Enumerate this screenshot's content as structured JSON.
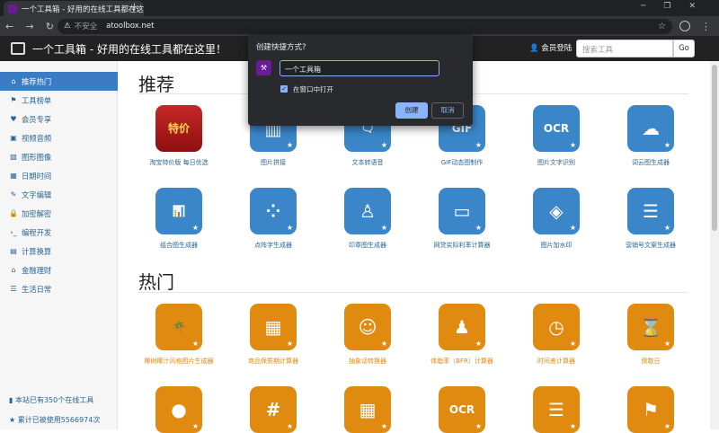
{
  "browser": {
    "tab_title": "一个工具箱 - 好用的在线工具都在这里！",
    "new_tab": "+",
    "security_label": "不安全",
    "url": "atoolbox.net"
  },
  "site": {
    "title": "一个工具箱 - 好用的在线工具都在这里！",
    "login_label": "会员登陆",
    "search_placeholder": "搜索工具",
    "go_label": "Go"
  },
  "sidebar": {
    "items": [
      {
        "icon": "home-icon",
        "glyph": "⌂",
        "label": "推荐热门"
      },
      {
        "icon": "flag-icon",
        "glyph": "⚑",
        "label": "工具榜单"
      },
      {
        "icon": "heart-icon",
        "glyph": "♥",
        "label": "会员专享"
      },
      {
        "icon": "film-icon",
        "glyph": "▣",
        "label": "视频音频"
      },
      {
        "icon": "image-icon",
        "glyph": "▨",
        "label": "图形图像"
      },
      {
        "icon": "calendar-icon",
        "glyph": "▦",
        "label": "日期时间"
      },
      {
        "icon": "pen-icon",
        "glyph": "✎",
        "label": "文字编辑"
      },
      {
        "icon": "lock-icon",
        "glyph": "🔒",
        "label": "加密解密"
      },
      {
        "icon": "terminal-icon",
        "glyph": "›_",
        "label": "编程开发"
      },
      {
        "icon": "calculator-icon",
        "glyph": "▤",
        "label": "计算换算"
      },
      {
        "icon": "bank-icon",
        "glyph": "⌂",
        "label": "金融理财"
      },
      {
        "icon": "list-icon",
        "glyph": "☰",
        "label": "生活日常"
      }
    ],
    "footer_tools": "本站已有350个在线工具",
    "footer_uses": "累计已被使用5566974次"
  },
  "sections": {
    "recommended": "推荐",
    "popular": "热门"
  },
  "recommended_row1": [
    {
      "icon": "taobao-promo-image",
      "glyph": "特价",
      "label": "淘宝特价版 每日优选",
      "style": "image"
    },
    {
      "icon": "image-collage-icon",
      "glyph": "▥",
      "label": "图片拼接",
      "style": "blue"
    },
    {
      "icon": "speech-bubble-icon",
      "glyph": "🗨",
      "label": "文本转语音",
      "style": "blue"
    },
    {
      "icon": "gif-film-icon",
      "glyph": "GIF",
      "label": "GIF动态图制作",
      "style": "blue"
    },
    {
      "icon": "ocr-icon",
      "glyph": "OCR",
      "label": "图片文字识别",
      "style": "blue"
    },
    {
      "icon": "cloud-icon",
      "glyph": "☁",
      "label": "词云图生成器",
      "style": "blue"
    }
  ],
  "recommended_row2": [
    {
      "icon": "bar-chart-icon",
      "glyph": "📊",
      "label": "组合图生成器",
      "style": "blue"
    },
    {
      "icon": "dot-matrix-icon",
      "glyph": "⁘",
      "label": "点阵字生成器",
      "style": "blue"
    },
    {
      "icon": "stamp-icon",
      "glyph": "♙",
      "label": "印章图生成器",
      "style": "blue"
    },
    {
      "icon": "monitor-icon",
      "glyph": "▭",
      "label": "网贷实际利率计算器",
      "style": "blue"
    },
    {
      "icon": "layers-icon",
      "glyph": "◈",
      "label": "图片加水印",
      "style": "blue"
    },
    {
      "icon": "document-icon",
      "glyph": "☰",
      "label": "营销号文案生成器",
      "style": "blue"
    }
  ],
  "popular_row1": [
    {
      "icon": "palm-tree-icon",
      "glyph": "🌴",
      "label": "椰树椰汁风格图片生成器",
      "style": "orange"
    },
    {
      "icon": "calendar-grid-icon",
      "glyph": "▦",
      "label": "商品保质期计算器",
      "style": "orange"
    },
    {
      "icon": "smiley-icon",
      "glyph": "☺",
      "label": "抽象话转换器",
      "style": "orange"
    },
    {
      "icon": "person-icon",
      "glyph": "♟",
      "label": "体脂率（BFR）计算器",
      "style": "orange"
    },
    {
      "icon": "clock-icon",
      "glyph": "◷",
      "label": "时间差计算器",
      "style": "orange"
    },
    {
      "icon": "hourglass-icon",
      "glyph": "⌛",
      "label": "倒数日",
      "style": "orange"
    }
  ],
  "popular_row2": [
    {
      "icon": "tomato-icon",
      "glyph": "●",
      "label": "",
      "style": "orange"
    },
    {
      "icon": "hash-grid-icon",
      "glyph": "#",
      "label": "",
      "style": "orange"
    },
    {
      "icon": "table-grid-icon",
      "glyph": "▦",
      "label": "",
      "style": "orange"
    },
    {
      "icon": "ocr-icon",
      "glyph": "OCR",
      "label": "",
      "style": "orange"
    },
    {
      "icon": "document-icon",
      "glyph": "☰",
      "label": "",
      "style": "orange"
    },
    {
      "icon": "people-board-icon",
      "glyph": "⚑",
      "label": "",
      "style": "orange"
    }
  ],
  "dialog": {
    "title": "创建快捷方式?",
    "name_value": "一个工具箱",
    "open_in_window_label": "在窗口中打开",
    "open_in_window_checked": true,
    "create_label": "创建",
    "cancel_label": "取消"
  },
  "colors": {
    "accent_blue": "#3a86c8",
    "accent_orange": "#e08a10",
    "header_dark": "#222222"
  }
}
